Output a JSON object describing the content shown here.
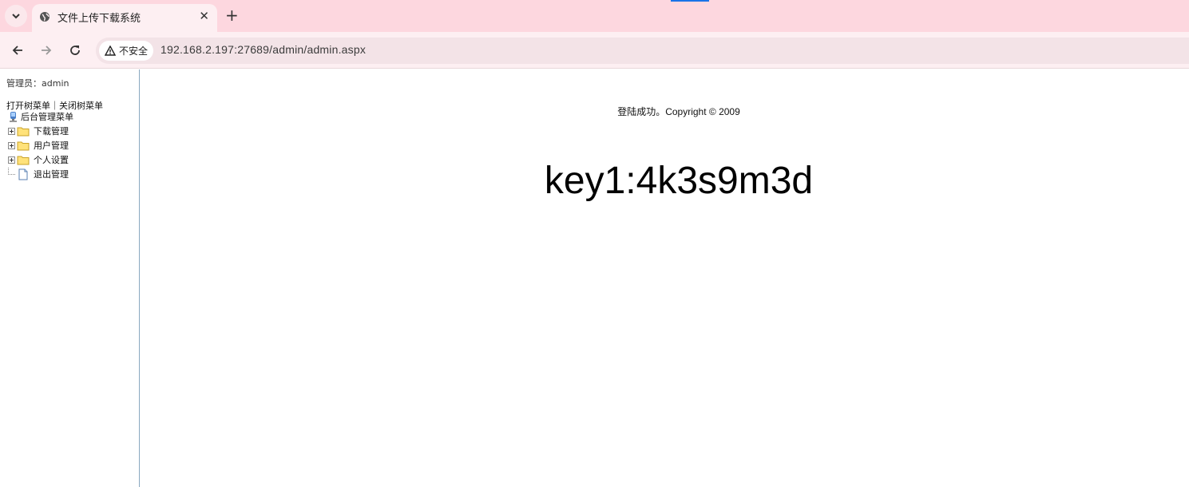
{
  "browser": {
    "tab_title": "文件上传下载系统",
    "tab_close": "✕",
    "new_tab": "+",
    "security_label": "不安全",
    "url": "192.168.2.197:27689/admin/admin.aspx"
  },
  "sidebar": {
    "admin_line": "管理员：admin",
    "tree_controls": "打开树菜单｜关闭树菜单",
    "root_label": "后台管理菜单",
    "items": [
      {
        "label": "下载管理"
      },
      {
        "label": "用户管理"
      },
      {
        "label": "个人设置"
      },
      {
        "label": "退出管理"
      }
    ]
  },
  "main": {
    "notice": "登陆成功。Copyright © 2009",
    "key": "key1:4k3s9m3d"
  }
}
